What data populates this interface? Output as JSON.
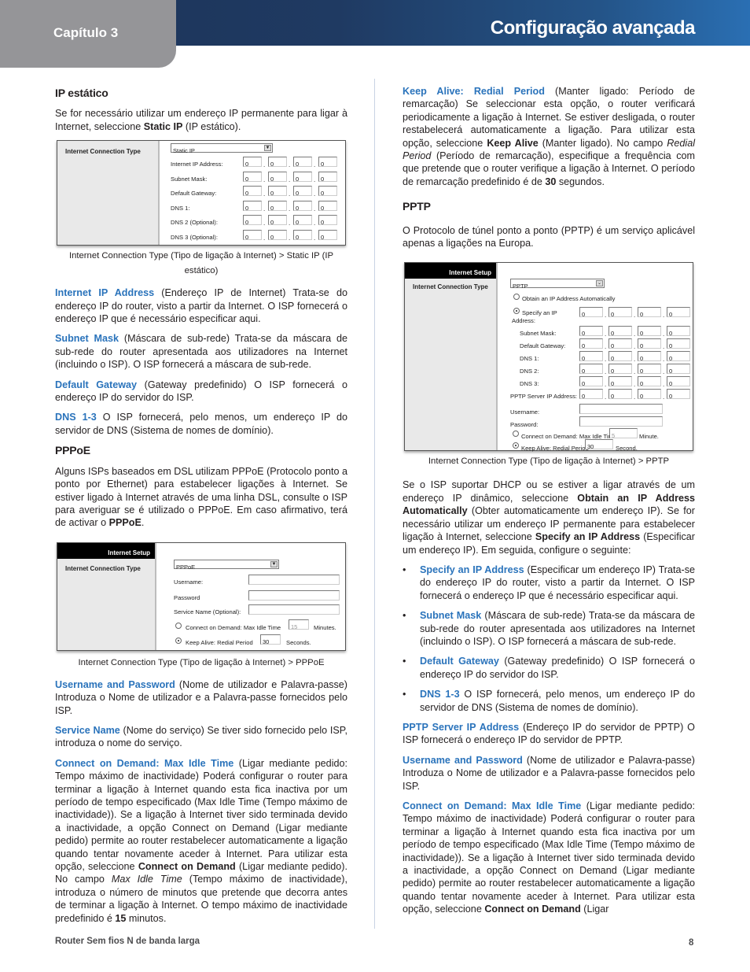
{
  "header": {
    "chapter": "Capítulo 3",
    "title": "Configuração avançada"
  },
  "left": {
    "static_ip": {
      "heading": "IP estático",
      "intro_pre": "Se for necessário utilizar um endereço IP permanente para ligar à Internet, seleccione ",
      "intro_bold": "Static IP",
      "intro_post": " (IP estático).",
      "figure": {
        "side_label": "Internet Connection Type",
        "select_value": "Static IP",
        "rows": [
          {
            "label": "Internet IP Address:",
            "octets": [
              "0",
              "0",
              "0",
              "0"
            ]
          },
          {
            "label": "Subnet Mask:",
            "octets": [
              "0",
              "0",
              "0",
              "0"
            ]
          },
          {
            "label": "Default Gateway:",
            "octets": [
              "0",
              "0",
              "0",
              "0"
            ]
          },
          {
            "label": "DNS 1:",
            "octets": [
              "0",
              "0",
              "0",
              "0"
            ]
          },
          {
            "label": "DNS 2 (Optional):",
            "octets": [
              "0",
              "0",
              "0",
              "0"
            ]
          },
          {
            "label": "DNS 3 (Optional):",
            "octets": [
              "0",
              "0",
              "0",
              "0"
            ]
          }
        ]
      },
      "caption": "Internet Connection Type (Tipo de ligação à Internet) > Static IP (IP estático)",
      "paras": [
        {
          "term": "Internet IP Address",
          "text": " (Endereço IP de Internet) Trata-se do endereço IP do router, visto a partir da Internet. O ISP fornecerá o endereço IP que é necessário especificar aqui."
        },
        {
          "term": "Subnet Mask",
          "text": " (Máscara de sub-rede) Trata-se da máscara de sub-rede do router apresentada aos utilizadores na Internet (incluindo o ISP). O ISP fornecerá a máscara de sub-rede."
        },
        {
          "term": "Default Gateway",
          "text": " (Gateway predefinido) O ISP fornecerá o endereço IP do servidor do ISP."
        },
        {
          "term": "DNS 1-3",
          "text": " O ISP fornecerá, pelo menos, um endereço IP do servidor de DNS (Sistema de nomes de domínio)."
        }
      ]
    },
    "pppoe": {
      "heading": "PPPoE",
      "intro_pre": "Alguns ISPs baseados em DSL utilizam PPPoE (Protocolo ponto a ponto por Ethernet) para estabelecer ligações à Internet. Se estiver ligado à Internet através de uma linha DSL, consulte o ISP para averiguar se é utilizado o PPPoE. Em caso afirmativo, terá de activar o ",
      "intro_bold": "PPPoE",
      "intro_post": ".",
      "figure": {
        "side_header": "Internet Setup",
        "side_label": "Internet Connection Type",
        "select_value": "PPPoE",
        "username_label": "Username:",
        "password_label": "Password",
        "service_label": "Service Name (Optional):",
        "connect_label": "Connect on Demand: Max Idle Time",
        "connect_value": "15",
        "connect_unit": "Minutes.",
        "keep_label": "Keep Alive: Redial Period",
        "keep_value": "30",
        "keep_unit": "Seconds."
      },
      "caption": "Internet Connection Type (Tipo de ligação à Internet) > PPPoE",
      "p_user_term": "Username and Password",
      "p_user_text": " (Nome de utilizador e Palavra-passe) Introduza o Nome de utilizador e a Palavra-passe fornecidos pelo ISP.",
      "p_service_term": "Service Name",
      "p_service_text": " (Nome do serviço) Se tiver sido fornecido pelo ISP, introduza o nome do serviço.",
      "p_connect_term": "Connect on Demand: Max Idle Time",
      "p_connect_1": " (Ligar mediante pedido: Tempo máximo de inactividade) Poderá configurar o router para terminar a ligação à Internet quando esta fica inactiva por um período de tempo especificado (Max Idle Time (Tempo máximo de inactividade)). Se a ligação à Internet tiver sido terminada devido a inactividade, a opção Connect on Demand (Ligar mediante pedido) permite ao router restabelecer automaticamente a ligação quando tentar novamente aceder à Internet. Para utilizar esta opção, seleccione ",
      "p_connect_bold": "Connect on Demand",
      "p_connect_2": " (Ligar mediante pedido). No campo ",
      "p_connect_ital": "Max Idle Time",
      "p_connect_3": " (Tempo máximo de inactividade), introduza o número de minutos que pretende que decorra antes de terminar a ligação à Internet. O tempo máximo de inactividade predefinido é ",
      "p_connect_num": "15",
      "p_connect_4": " minutos."
    }
  },
  "right": {
    "keep_term": "Keep Alive: Redial Period",
    "keep_1": " (Manter ligado: Período de remarcação) Se seleccionar esta opção, o router verificará periodicamente a ligação à Internet. Se estiver desligada, o router restabelecerá automaticamente a ligação. Para utilizar esta opção, seleccione ",
    "keep_bold": "Keep Alive",
    "keep_2": " (Manter ligado). No campo ",
    "keep_ital": "Redial Period",
    "keep_3": " (Período de remarcação), especifique a frequência com que pretende que o router verifique a ligação à Internet. O período de remarcação predefinido é de ",
    "keep_num": "30",
    "keep_4": " segundos.",
    "pptp": {
      "heading": "PPTP",
      "intro": "O Protocolo de túnel ponto a ponto (PPTP) é um serviço aplicável apenas a ligações na Europa.",
      "figure": {
        "side_header": "Internet Setup",
        "side_label": "Internet Connection Type",
        "select_value": "PPTP",
        "obtain_label": "Obtain an IP Address Automatically",
        "specify_label_1": "Specify an IP",
        "specify_label_2": "Address:",
        "specify_octets": [
          "0",
          "0",
          "0",
          "0"
        ],
        "rows": [
          {
            "label": "Subnet Mask:",
            "octets": [
              "0",
              "0",
              "0",
              "0"
            ]
          },
          {
            "label": "Default Gateway:",
            "octets": [
              "0",
              "0",
              "0",
              "0"
            ]
          },
          {
            "label": "DNS 1:",
            "octets": [
              "0",
              "0",
              "0",
              "0"
            ]
          },
          {
            "label": "DNS 2:",
            "octets": [
              "0",
              "0",
              "0",
              "0"
            ]
          },
          {
            "label": "DNS 3:",
            "octets": [
              "0",
              "0",
              "0",
              "0"
            ]
          }
        ],
        "server_label": "PPTP Server IP Address:",
        "server_octets": [
          "0",
          "0",
          "0",
          "0"
        ],
        "username_label": "Username:",
        "password_label": "Password:",
        "connect_label": "Connect on Demand: Max Idle Time",
        "connect_value": "5",
        "connect_unit": "Minute.",
        "keep_label": "Keep Alive: Redial Period",
        "keep_value": "30",
        "keep_unit": "Second."
      },
      "caption": "Internet Connection Type (Tipo de ligação à Internet) > PPTP",
      "dhcp_1": "Se o ISP suportar DHCP ou se estiver a ligar através de um endereço IP dinâmico, seleccione ",
      "dhcp_bold1": "Obtain an IP Address Automatically",
      "dhcp_2": " (Obter automaticamente um endereço IP). Se for necessário utilizar um endereço IP permanente para estabelecer ligação à Internet, seleccione ",
      "dhcp_bold2": "Specify an IP Address",
      "dhcp_3": " (Especificar um endereço IP). Em seguida, configure o seguinte:",
      "bullets": [
        {
          "term": "Specify an IP Address",
          "text": " (Especificar um endereço IP) Trata-se do endereço IP do router, visto a partir da Internet. O ISP fornecerá o endereço IP que é necessário especificar aqui."
        },
        {
          "term": "Subnet Mask",
          "text": " (Máscara de sub-rede) Trata-se da máscara de sub-rede do router apresentada aos utilizadores na Internet (incluindo o ISP). O ISP fornecerá a máscara de sub-rede."
        },
        {
          "term": "Default Gateway",
          "text": " (Gateway predefinido) O ISP fornecerá o endereço IP do servidor do ISP."
        },
        {
          "term": "DNS 1-3",
          "text": " O ISP fornecerá, pelo menos, um endereço IP do servidor de DNS (Sistema de nomes de domínio)."
        }
      ],
      "p_server_term": "PPTP Server IP Address",
      "p_server_text": " (Endereço IP do servidor de PPTP) O ISP fornecerá o endereço IP do servidor de PPTP.",
      "p_user_term": "Username and Password",
      "p_user_text": " (Nome de utilizador e Palavra-passe) Introduza o Nome de utilizador e a Palavra-passe fornecidos pelo ISP.",
      "p_connect_term": "Connect on Demand: Max Idle Time",
      "p_connect_1": " (Ligar mediante pedido: Tempo máximo de inactividade) Poderá configurar o router para terminar a ligação à Internet quando esta fica inactiva por um período de tempo especificado (Max Idle Time (Tempo máximo de inactividade)). Se a ligação à Internet tiver sido terminada devido a inactividade, a opção Connect on Demand (Ligar mediante pedido) permite ao router restabelecer automaticamente a ligação quando tentar novamente aceder à Internet. Para utilizar esta opção, seleccione ",
      "p_connect_bold": "Connect on Demand",
      "p_connect_2": " (Ligar"
    }
  },
  "footer": {
    "product": "Router Sem fios N de banda larga",
    "page": "8"
  }
}
